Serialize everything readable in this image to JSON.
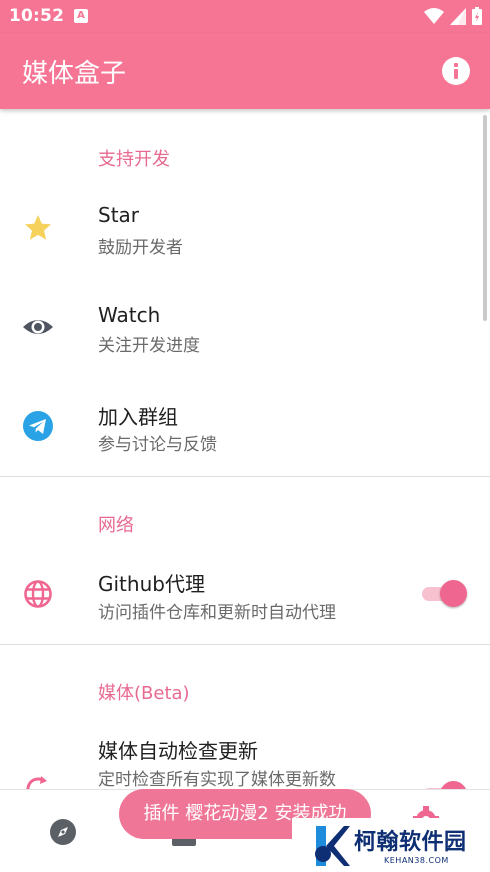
{
  "status": {
    "time": "10:52",
    "notif_letter": "A"
  },
  "app": {
    "title": "媒体盒子"
  },
  "sections": {
    "support": {
      "title": "支持开发",
      "items": [
        {
          "title": "Star",
          "subtitle": "鼓励开发者",
          "icon": "star-icon"
        },
        {
          "title": "Watch",
          "subtitle": "关注开发进度",
          "icon": "eye-icon"
        },
        {
          "title": "加入群组",
          "subtitle": "参与讨论与反馈",
          "icon": "telegram-icon"
        }
      ]
    },
    "network": {
      "title": "网络",
      "items": [
        {
          "title": "Github代理",
          "subtitle": "访问插件仓库和更新时自动代理",
          "icon": "globe-icon",
          "toggle": true
        }
      ]
    },
    "media": {
      "title": "媒体(Beta)",
      "items": [
        {
          "title": "媒体自动检查更新",
          "subtitle": "定时检查所有实现了媒体更新数",
          "icon": "refresh-icon",
          "toggle": true
        }
      ]
    }
  },
  "toast": {
    "message": "插件 樱花动漫2 安装成功"
  },
  "watermark": {
    "brand": "柯翰软件园",
    "url": "KEHAN38.COM"
  },
  "colors": {
    "accent": "#f67595",
    "section": "#e86a90",
    "star": "#f6d25d",
    "telegram": "#2aa2e6"
  }
}
